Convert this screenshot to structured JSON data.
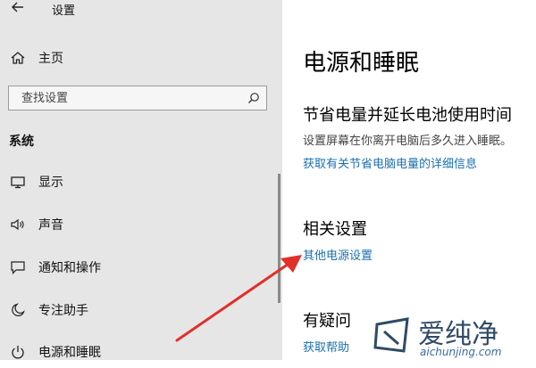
{
  "window": {
    "title": "设置"
  },
  "sidebar": {
    "home_label": "主页",
    "search": {
      "placeholder": "查找设置"
    },
    "group_header": "系统",
    "items": [
      {
        "label": "显示",
        "icon": "monitor-icon"
      },
      {
        "label": "声音",
        "icon": "speaker-icon"
      },
      {
        "label": "通知和操作",
        "icon": "notification-icon"
      },
      {
        "label": "专注助手",
        "icon": "moon-icon"
      },
      {
        "label": "电源和睡眠",
        "icon": "power-icon"
      }
    ]
  },
  "main": {
    "title": "电源和睡眠",
    "battery_section": {
      "title": "节省电量并延长电池使用时间",
      "description": "设置屏幕在你离开电脑后多久进入睡眠。",
      "link": "获取有关节省电脑电量的详细信息"
    },
    "related_section": {
      "title": "相关设置",
      "link": "其他电源设置"
    },
    "question_section": {
      "title": "有疑问",
      "link": "获取帮助"
    }
  },
  "watermark": {
    "text": "爱纯净",
    "url": "aichunjing.com"
  },
  "colors": {
    "sidebar_bg": "#e6e6e6",
    "link": "#1a6fb0",
    "arrow": "#e0302a"
  }
}
